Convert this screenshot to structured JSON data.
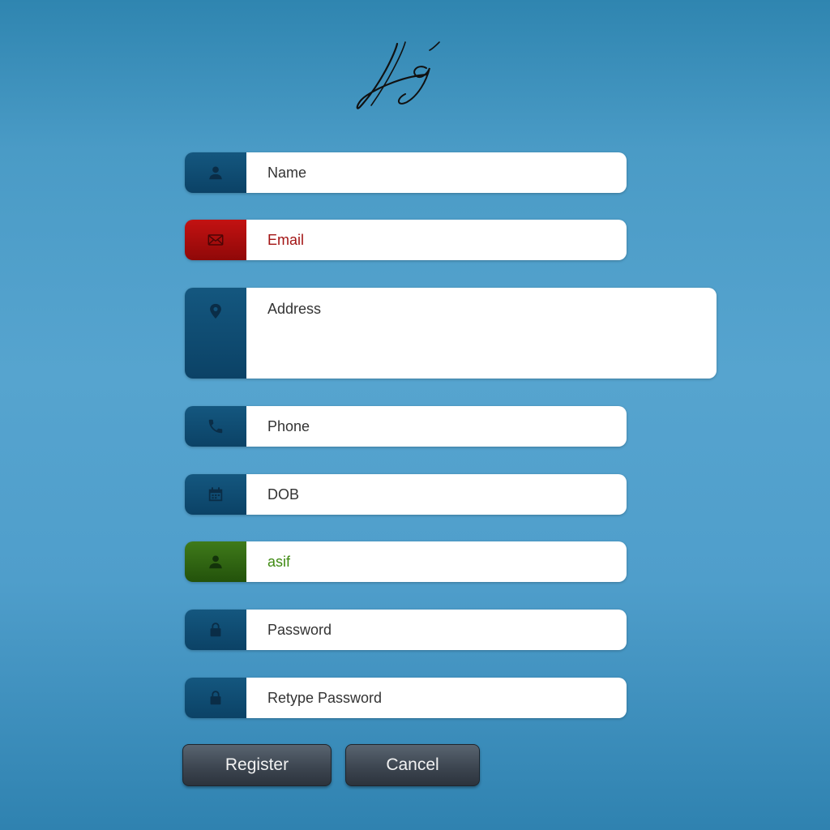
{
  "logo": {
    "text": "fg"
  },
  "form": {
    "fields": [
      {
        "icon": "user-icon",
        "placeholder": "Name"
      },
      {
        "icon": "envelope-icon",
        "placeholder": "Email"
      },
      {
        "icon": "map-marker-icon",
        "placeholder": "Address"
      },
      {
        "icon": "phone-icon",
        "placeholder": "Phone"
      },
      {
        "icon": "calendar-icon",
        "placeholder": "DOB"
      },
      {
        "icon": "user-icon",
        "value": "asif"
      },
      {
        "icon": "lock-icon",
        "placeholder": "Password"
      },
      {
        "icon": "lock-icon",
        "placeholder": "Retype Password"
      }
    ],
    "buttons": {
      "register": "Register",
      "cancel": "Cancel"
    }
  },
  "colors": {
    "background": "#4a9bc6",
    "icon_box_default": "#0f4d75",
    "icon_box_error": "#b10e0e",
    "icon_box_success": "#336914",
    "error_text": "#a31515",
    "success_text": "#3f8a12"
  }
}
